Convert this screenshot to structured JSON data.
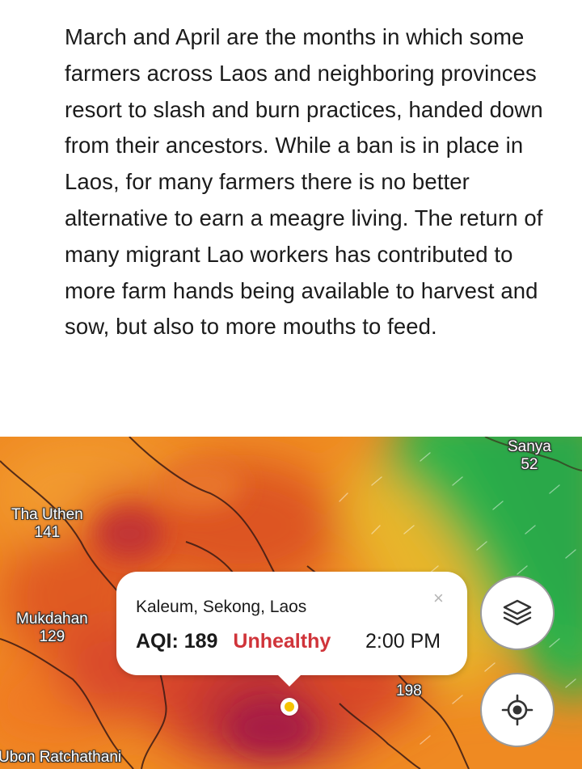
{
  "article": {
    "paragraph": "March and April are the months in which some farmers across Laos and neighboring provinces resort to slash and burn practices, handed down from their ancestors.  While a ban is in place in Laos, for many farmers there is no better alternative to earn a meagre living.   The return of many migrant Lao workers has contributed to more farm hands being available to harvest and sow, but also to more mouths to feed."
  },
  "map": {
    "cities": [
      {
        "name": "Sanya",
        "aqi": "52"
      },
      {
        "name": "Tha Uthen",
        "aqi": "141"
      },
      {
        "name": "Mukdahan",
        "aqi": "129"
      },
      {
        "name": "Ubon Ratchathani",
        "aqi": ""
      }
    ],
    "station_value": "198",
    "popup": {
      "location": "Kaleum, Sekong, Laos",
      "aqi_label": "AQI:",
      "aqi_value": "189",
      "status": "Unhealthy",
      "status_color": "#d0343a",
      "time": "2:00 PM",
      "close_icon": "close-icon"
    },
    "buttons": {
      "layers_icon": "layers-icon",
      "locate_icon": "crosshair-icon"
    },
    "colors": {
      "green": "#3fb349",
      "orange": "#f0821e",
      "red": "#d8401f",
      "purple": "#a8213d",
      "yellow": "#f5c200"
    }
  }
}
